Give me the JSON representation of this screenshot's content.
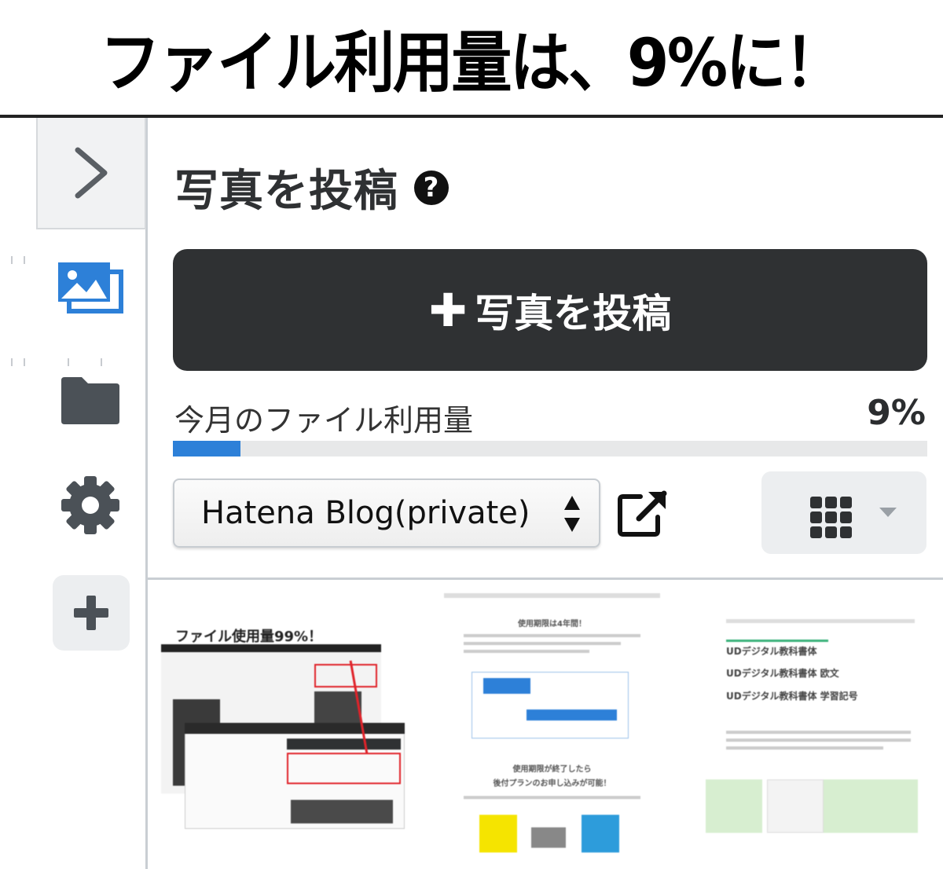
{
  "banner": {
    "headline": "ファイル利用量は、9%に！"
  },
  "sidebar": {
    "toggle_icon": "chevron-right-icon",
    "items": [
      {
        "icon": "photos-icon",
        "color": "#2d80d8"
      },
      {
        "icon": "folder-icon",
        "color": "#4b5157"
      },
      {
        "icon": "gear-icon",
        "color": "#4b5157"
      },
      {
        "icon": "plus-icon",
        "color": "#4b5157"
      }
    ]
  },
  "panel": {
    "title": "写真を投稿",
    "help_icon": "question-circle-icon",
    "post_button_label": "写真を投稿",
    "usage": {
      "label": "今月のファイル利用量",
      "value_text": "9%",
      "percent": 9
    },
    "blog_select": {
      "selected": "Hatena Blog(private)"
    },
    "external_icon": "external-link-icon",
    "view_toggle_icon": "grid-icon"
  },
  "gallery": {
    "thumb1": {
      "title": "ファイル使用量99%！"
    },
    "thumb2": {
      "heading1": "使用期限は4年間！",
      "heading2": "使用期限が終了したら",
      "heading3": "後付プランのお申し込みが可能！"
    },
    "thumb3": {
      "line1": "UDデジタル教科書体",
      "line2": "UDデジタル教科書体 欧文",
      "line3": "UDデジタル教科書体 学習記号"
    }
  },
  "colors": {
    "accent": "#2d80d8",
    "button_dark": "#2f3133",
    "track": "#e7e8e9"
  }
}
